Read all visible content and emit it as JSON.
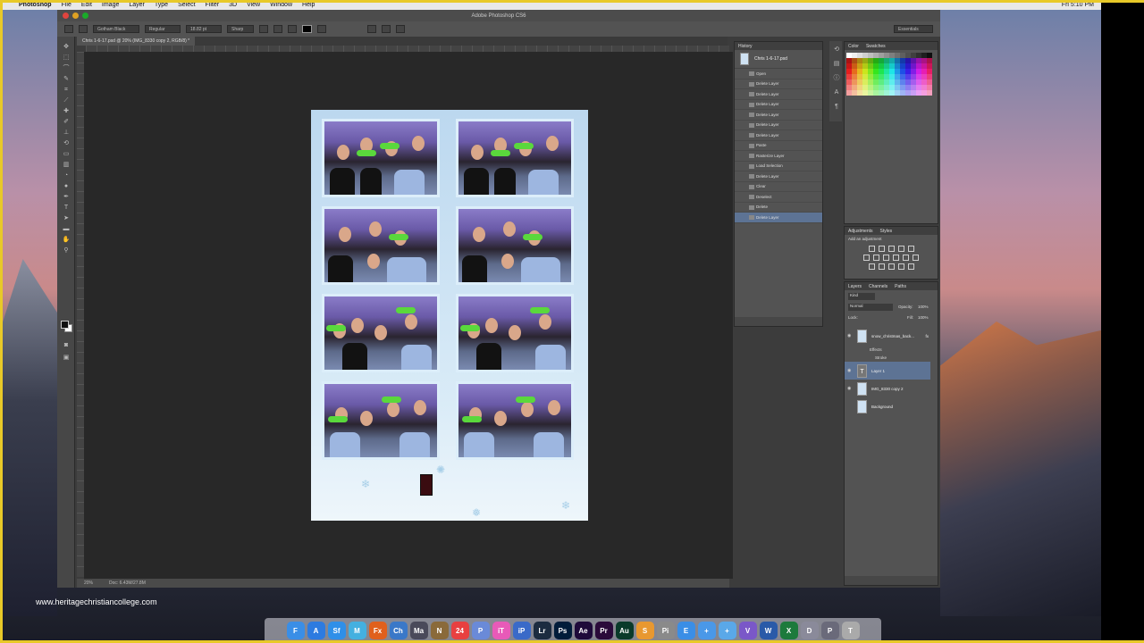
{
  "menubar": {
    "app": "Photoshop",
    "items": [
      "File",
      "Edit",
      "Image",
      "Layer",
      "Type",
      "Select",
      "Filter",
      "3D",
      "View",
      "Window",
      "Help"
    ],
    "clock": "Fri 5:10 PM"
  },
  "window": {
    "title": "Adobe Photoshop CS6",
    "document_tab": "Chris 1-6-17.psd @ 20% (IMG_8330 copy 2, RGB/8) *",
    "workspace": "Essentials"
  },
  "options_bar": {
    "font_family": "Gotham Black",
    "font_style": "Regular",
    "font_size": "18.82 pt",
    "anti_alias": "Sharp"
  },
  "status_bar": {
    "zoom": "20%",
    "doc_size": "Doc: 6.43M/27.8M"
  },
  "history_panel": {
    "title": "History",
    "snapshot": "Chris 1-6-17.psd",
    "items": [
      "Open",
      "Delete Layer",
      "Delete Layer",
      "Delete Layer",
      "Delete Layer",
      "Delete Layer",
      "Delete Layer",
      "Paste",
      "Rasterize Layer",
      "Load Selection",
      "Delete Layer",
      "Clear",
      "Deselect",
      "Delete",
      "Delete Layer"
    ],
    "active_index": 14
  },
  "swatches_panel": {
    "tabs": [
      "Color",
      "Swatches"
    ]
  },
  "adjustments_panel": {
    "tabs": [
      "Adjustments",
      "Styles"
    ],
    "prompt": "Add an adjustment"
  },
  "layers_panel": {
    "tabs": [
      "Layers",
      "Channels",
      "Paths"
    ],
    "filter": "Kind",
    "blend_mode": "Normal",
    "opacity_label": "Opacity:",
    "opacity": "100%",
    "lock_label": "Lock:",
    "fill_label": "Fill:",
    "fill": "100%",
    "layers": [
      {
        "name": "snow_christmas_back...",
        "visible": true,
        "fx": "fx"
      },
      {
        "name": "T",
        "visible": true,
        "is_text": true,
        "label": "Layer 1"
      },
      {
        "name": "IMG_8330 copy 2",
        "visible": true
      },
      {
        "name": "Background",
        "visible": false
      }
    ],
    "effects_label": "Effects",
    "effect_item": "Stroke",
    "active_index": 1
  },
  "watermark": "www.heritagechristiancollege.com",
  "dock": [
    {
      "label": "F",
      "color": "#3a8ee6"
    },
    {
      "label": "A",
      "color": "#2d7be0"
    },
    {
      "label": "Sf",
      "color": "#2f8fe8"
    },
    {
      "label": "M",
      "color": "#44b0e0"
    },
    {
      "label": "Fx",
      "color": "#e0601c"
    },
    {
      "label": "Ch",
      "color": "#3a78c8"
    },
    {
      "label": "Ma",
      "color": "#4a4a5a"
    },
    {
      "label": "N",
      "color": "#8a6a3a"
    },
    {
      "label": "24",
      "color": "#e84040"
    },
    {
      "label": "P",
      "color": "#6a8ad8"
    },
    {
      "label": "iT",
      "color": "#e85ab8"
    },
    {
      "label": "iP",
      "color": "#3a6ac8"
    },
    {
      "label": "Lr",
      "color": "#1c2c40"
    },
    {
      "label": "Ps",
      "color": "#001c3a"
    },
    {
      "label": "Ae",
      "color": "#1e0a3a"
    },
    {
      "label": "Pr",
      "color": "#2a0a3a"
    },
    {
      "label": "Au",
      "color": "#0a3a2a"
    },
    {
      "label": "S",
      "color": "#e89830"
    },
    {
      "label": "Pi",
      "color": "#8a8a8a"
    },
    {
      "label": "E",
      "color": "#3a8ee6"
    },
    {
      "label": "+",
      "color": "#4a98e8"
    },
    {
      "label": "+",
      "color": "#5aa8e8"
    },
    {
      "label": "V",
      "color": "#7a58c8"
    },
    {
      "label": "W",
      "color": "#2a5aa8"
    },
    {
      "label": "X",
      "color": "#1c7a3c"
    },
    {
      "label": "D",
      "color": "#8a8a9a"
    },
    {
      "label": "P",
      "color": "#6a6a7a"
    },
    {
      "label": "T",
      "color": "#aaaaaa"
    }
  ]
}
